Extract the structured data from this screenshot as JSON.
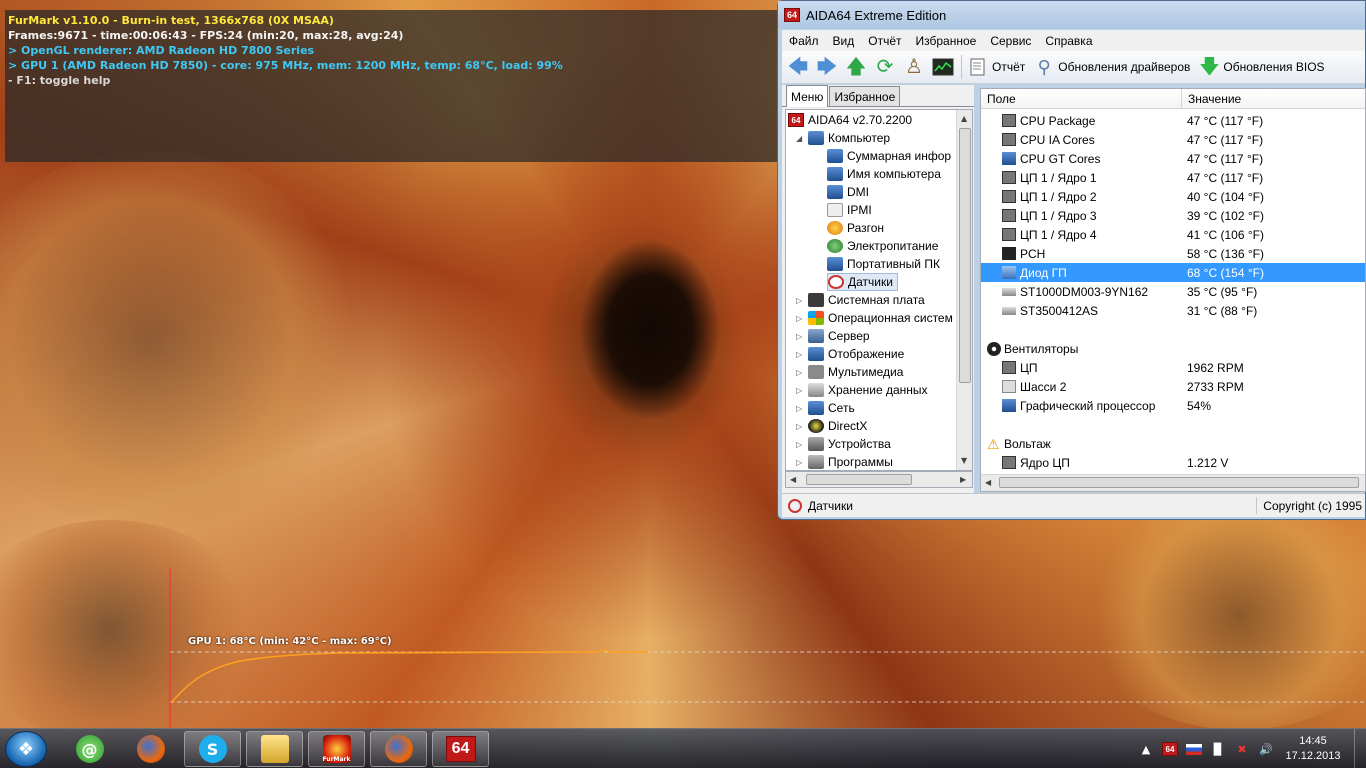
{
  "furmark": {
    "line1": "FurMark v1.10.0 - Burn-in test, 1366x768 (0X MSAA)",
    "line2": "Frames:9671 - time:00:06:43 - FPS:24 (min:20, max:28, avg:24)",
    "line3": "> OpenGL renderer: AMD Radeon HD 7800 Series",
    "line4": "> GPU 1 (AMD Radeon HD 7850) - core: 975 MHz, mem: 1200 MHz, temp: 68°C, load: 99%",
    "line5": "- F1: toggle help",
    "graph_label": "GPU 1: 68°C (min: 42°C - max: 69°C)",
    "graph": {
      "current": 68,
      "min": 42,
      "max": 69,
      "unit": "°C"
    }
  },
  "aida": {
    "title": "AIDA64 Extreme Edition",
    "logo": "64",
    "menu": [
      "Файл",
      "Вид",
      "Отчёт",
      "Избранное",
      "Сервис",
      "Справка"
    ],
    "toolbar": {
      "report_label": "Отчёт",
      "drivers_label": "Обновления драйверов",
      "bios_label": "Обновления BIOS"
    },
    "tabs": [
      "Меню",
      "Избранное"
    ],
    "tree": {
      "root": "AIDA64 v2.70.2200",
      "computer": "Компьютер",
      "computer_children": [
        "Суммарная инфор",
        "Имя компьютера",
        "DMI",
        "IPMI",
        "Разгон",
        "Электропитание",
        "Портативный ПК",
        "Датчики"
      ],
      "sections": [
        "Системная плата",
        "Операционная систем",
        "Сервер",
        "Отображение",
        "Мультимедиа",
        "Хранение данных",
        "Сеть",
        "DirectX",
        "Устройства",
        "Программы"
      ]
    },
    "columns": {
      "field": "Поле",
      "value": "Значение"
    },
    "temps": [
      {
        "field": "CPU Package",
        "value": "47 °C  (117 °F)"
      },
      {
        "field": "CPU IA Cores",
        "value": "47 °C  (117 °F)"
      },
      {
        "field": "CPU GT Cores",
        "value": "47 °C  (117 °F)"
      },
      {
        "field": "ЦП 1 / Ядро 1",
        "value": "47 °C  (117 °F)"
      },
      {
        "field": "ЦП 1 / Ядро 2",
        "value": "40 °C  (104 °F)"
      },
      {
        "field": "ЦП 1 / Ядро 3",
        "value": "39 °C  (102 °F)"
      },
      {
        "field": "ЦП 1 / Ядро 4",
        "value": "41 °C  (106 °F)"
      },
      {
        "field": "PCH",
        "value": "58 °C  (136 °F)"
      },
      {
        "field": "Диод ГП",
        "value": "68 °C  (154 °F)"
      },
      {
        "field": "ST1000DM003-9YN162",
        "value": "35 °C  (95 °F)"
      },
      {
        "field": "ST3500412AS",
        "value": "31 °C  (88 °F)"
      }
    ],
    "fans_group": "Вентиляторы",
    "fans": [
      {
        "field": "ЦП",
        "value": "1962 RPM"
      },
      {
        "field": "Шасси 2",
        "value": "2733 RPM"
      },
      {
        "field": "Графический процессор",
        "value": "54%"
      }
    ],
    "volt_group": "Вольтаж",
    "volts": [
      {
        "field": "Ядро ЦП",
        "value": "1.212 V"
      }
    ],
    "status_left": "Датчики",
    "status_right": "Copyright (c) 1995"
  },
  "taskbar": {
    "time": "14:45",
    "date": "17.12.2013",
    "aida_tray": "64",
    "furmark_label": "FurMark",
    "aida_task": "64"
  }
}
